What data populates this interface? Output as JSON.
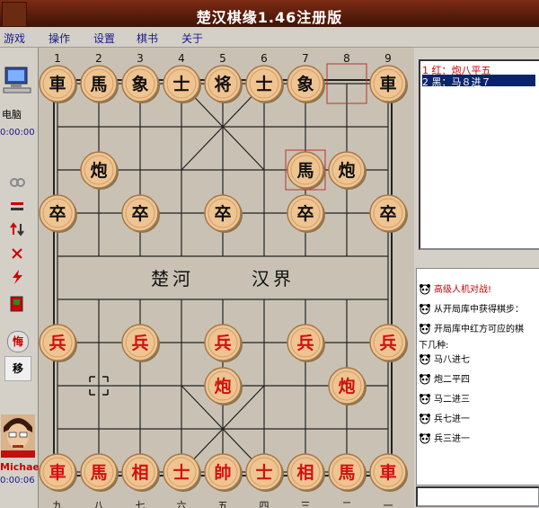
{
  "window": {
    "title": "楚汉棋缘1.46注册版"
  },
  "menu": [
    "游戏",
    "操作",
    "设置",
    "棋书",
    "关于"
  ],
  "left_panel": {
    "top_player_label": "电脑",
    "top_timer": "0:00:00",
    "bottom_player_name": "Michae",
    "bottom_timer": "0:00:06",
    "btn_hui": "悔",
    "btn_yi": "移"
  },
  "board": {
    "top_numbers": [
      "1",
      "2",
      "3",
      "4",
      "5",
      "6",
      "7",
      "8",
      "9"
    ],
    "bottom_numbers": [
      "九",
      "八",
      "七",
      "六",
      "五",
      "四",
      "三",
      "二",
      "一"
    ],
    "river_left": "楚河",
    "river_right": "汉界",
    "black_pieces": [
      {
        "label": "車",
        "file": 0,
        "rank": 0
      },
      {
        "label": "馬",
        "file": 1,
        "rank": 0
      },
      {
        "label": "象",
        "file": 2,
        "rank": 0
      },
      {
        "label": "士",
        "file": 3,
        "rank": 0
      },
      {
        "label": "将",
        "file": 4,
        "rank": 0
      },
      {
        "label": "士",
        "file": 5,
        "rank": 0
      },
      {
        "label": "象",
        "file": 6,
        "rank": 0
      },
      {
        "label": "車",
        "file": 8,
        "rank": 0
      },
      {
        "label": "炮",
        "file": 1,
        "rank": 2
      },
      {
        "label": "馬",
        "file": 6,
        "rank": 2
      },
      {
        "label": "炮",
        "file": 7,
        "rank": 2
      },
      {
        "label": "卒",
        "file": 0,
        "rank": 3
      },
      {
        "label": "卒",
        "file": 2,
        "rank": 3
      },
      {
        "label": "卒",
        "file": 4,
        "rank": 3
      },
      {
        "label": "卒",
        "file": 6,
        "rank": 3
      },
      {
        "label": "卒",
        "file": 8,
        "rank": 3
      }
    ],
    "red_pieces": [
      {
        "label": "兵",
        "file": 0,
        "rank": 6
      },
      {
        "label": "兵",
        "file": 2,
        "rank": 6
      },
      {
        "label": "兵",
        "file": 4,
        "rank": 6
      },
      {
        "label": "兵",
        "file": 6,
        "rank": 6
      },
      {
        "label": "兵",
        "file": 8,
        "rank": 6
      },
      {
        "label": "炮",
        "file": 4,
        "rank": 7
      },
      {
        "label": "炮",
        "file": 7,
        "rank": 7
      },
      {
        "label": "車",
        "file": 0,
        "rank": 9
      },
      {
        "label": "馬",
        "file": 1,
        "rank": 9
      },
      {
        "label": "相",
        "file": 2,
        "rank": 9
      },
      {
        "label": "士",
        "file": 3,
        "rank": 9
      },
      {
        "label": "帥",
        "file": 4,
        "rank": 9
      },
      {
        "label": "士",
        "file": 5,
        "rank": 9
      },
      {
        "label": "相",
        "file": 6,
        "rank": 9
      },
      {
        "label": "馬",
        "file": 7,
        "rank": 9
      },
      {
        "label": "車",
        "file": 8,
        "rank": 9
      }
    ],
    "last_move_from": {
      "file": 7,
      "rank": 0
    },
    "last_move_to": {
      "file": 6,
      "rank": 2
    },
    "cursor_mark": {
      "file": 1,
      "rank": 7
    }
  },
  "moves": [
    {
      "text": "1  红：炮八平五",
      "color": "#cc0000",
      "selected": false
    },
    {
      "text": "2  黑：马８进７",
      "color": "#ffffff",
      "selected": true
    }
  ],
  "chat": [
    {
      "text": "高级人机对战!",
      "color": "#cc0000",
      "icon": true
    },
    {
      "text": "从开局库中获得棋步：",
      "color": "#000000",
      "icon": true
    },
    {
      "text": "开局库中红方可应的棋",
      "color": "#000000",
      "icon": true
    },
    {
      "text": "下几种:",
      "color": "#000000",
      "icon": false
    },
    {
      "text": "马八进七",
      "color": "#000000",
      "icon": true
    },
    {
      "text": "炮二平四",
      "color": "#000000",
      "icon": true
    },
    {
      "text": "马二进三",
      "color": "#000000",
      "icon": true
    },
    {
      "text": "兵七进一",
      "color": "#000000",
      "icon": true
    },
    {
      "text": "兵三进一",
      "color": "#000000",
      "icon": true
    }
  ]
}
